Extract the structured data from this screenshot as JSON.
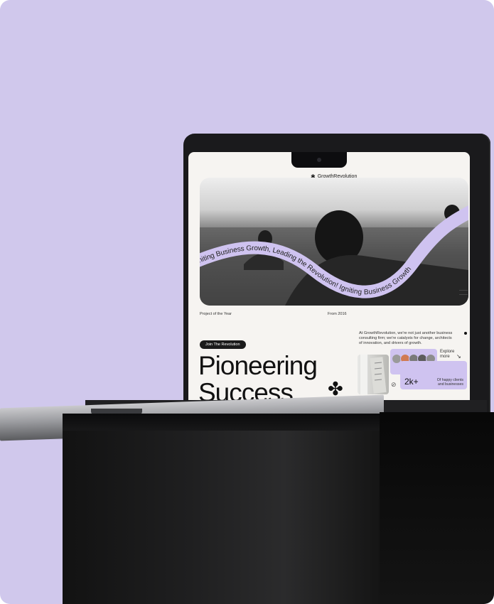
{
  "site": {
    "brand": "GrowthRevolution",
    "ribbon_text": "Igniting Business Growth, Leading the Revolution! Igniting Business Growth",
    "project_label": "Project of the Year",
    "since_label": "From 2016",
    "cta_badge": "Join The Revolution",
    "headline_line1": "Pioneering",
    "headline_line2": "Success",
    "about_text": "At GrowthRevolution, we're not just another business consulting firm; we're catalysts for change, architects of innovation, and drivers of growth.",
    "explore_label": "Explore more",
    "stat_value": "2k+",
    "stat_caption": "Of happy clients and businesses"
  },
  "colors": {
    "backdrop": "#d0c8ec",
    "accent": "#cfc3f0",
    "ink": "#111111"
  },
  "icons": [
    "asterisk-logo-icon",
    "menu-icon",
    "pinwheel-icon",
    "arrow-down-right-icon",
    "paperclip-icon"
  ]
}
